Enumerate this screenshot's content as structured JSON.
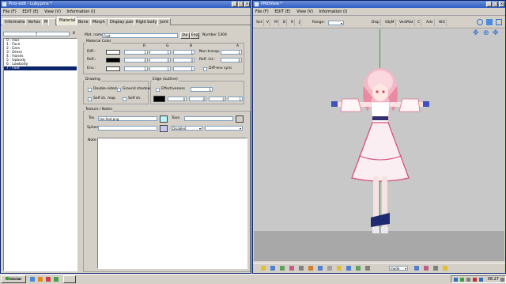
{
  "pmx_window": {
    "title": "Pmx edit - Luby.pmx *",
    "menu": [
      "File (F)",
      "EDIT (E)",
      "View (V)",
      "Information (I)"
    ],
    "tabs": [
      "Information",
      "Vertex",
      "M",
      "Material",
      "Bone",
      "Morph",
      "Display pane",
      "Rigid body",
      "Joint"
    ],
    "active_tab": "Material",
    "index_value": "7",
    "count_value": "8",
    "materials": [
      "0 : Hair",
      "1 : Face",
      "2 : Ears",
      "3 : Dress",
      "4 : Hands",
      "5 : Upbody",
      "6 : Lowbody",
      "7 : Foot"
    ],
    "selected_index": 7,
    "mat_name_label": "Mat. name",
    "mat_name_value": "Foot",
    "jap_label": "Jap",
    "eng_label": "Eng",
    "number_label": "Number 1304",
    "material_color_label": "Material Color",
    "rgba_headers": [
      "R",
      "G",
      "B",
      "A"
    ],
    "diff_label": "Diff.:",
    "diff_values": [
      "1",
      "1",
      "1",
      "1"
    ],
    "refl_label": "Refl.:",
    "refl_values": [
      "0",
      "0",
      "0",
      "0"
    ],
    "env_label": "Env.:",
    "env_values": [
      "1",
      "1",
      "1",
      "1"
    ],
    "non_transp_label": "Non-transp.:",
    "refl_int_label": "Refl. int.:",
    "diff_env_sync_label": "Diff-env sync",
    "drawing_label": "Drawing",
    "double_sided_label": "Double-sided",
    "ground_shadow_label": "Ground shadow",
    "self_sh_map_label": "Self sh. map",
    "self_sh_label": "Self sh.",
    "edge_label": "Edge (outline)",
    "effectiveness_label": "Effectiveness",
    "edge_size_value": "1",
    "edge_color_values": [
      "0",
      "0",
      "0",
      "1"
    ],
    "texture_notes_label": "Texture / Notes",
    "tex_label": "Tex",
    "tex_value": "tex.foot.png",
    "toon_label": "Toon",
    "sphere_label": "Sphere",
    "sphere_mode": "Disabled",
    "note_label": "Note"
  },
  "pmd_window": {
    "title": "PMDView *",
    "menu": [
      "File (F)",
      "EDIT (E)",
      "View (V)",
      "Information (I)"
    ],
    "toolbar": [
      "Sel:",
      "V",
      "M",
      "B",
      "R",
      "J",
      "Range:",
      "Disp",
      "ObjM",
      "VertMat",
      "C",
      "Adv",
      "WG"
    ],
    "mode_label": "mode"
  },
  "taskbar": {
    "start_label": "Iniciar",
    "clock": "08:27"
  },
  "colors": {
    "title_blue": "#2f5fc4",
    "viewport_bg": "#c8c8c8",
    "floor": "#a8a8a8",
    "tex_swatch": "#b9f5f5",
    "sphere_swatch": "#c7c7f0"
  }
}
